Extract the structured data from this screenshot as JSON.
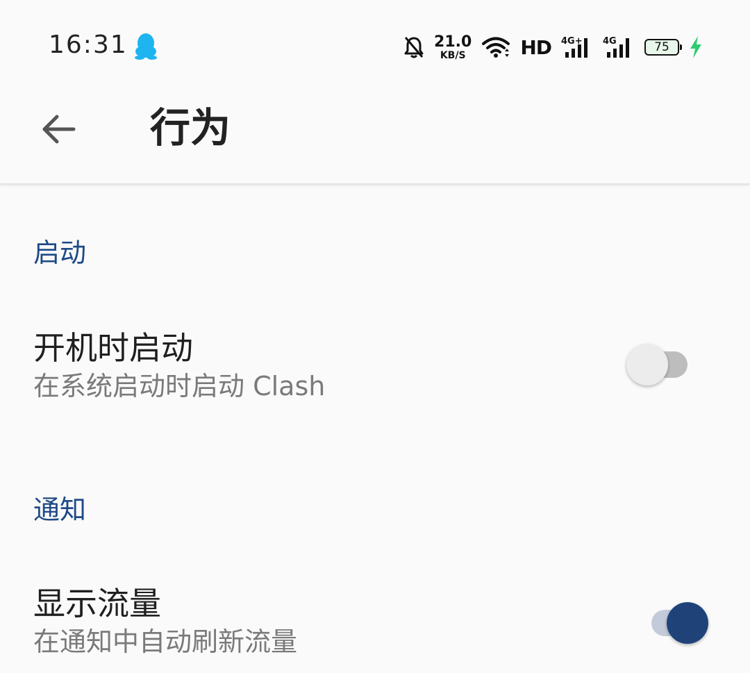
{
  "status_bar": {
    "time": "16:31",
    "net_speed_value": "21.0",
    "net_speed_unit": "KB/S",
    "hd_label": "HD",
    "signal1_label": "4G+",
    "signal2_label": "4G",
    "battery_level": "75",
    "icons": {
      "app": "qq-penguin-icon",
      "mute": "bell-off-icon",
      "wifi": "wifi-icon",
      "charging": "lightning-icon"
    },
    "colors": {
      "qq": "#1eb4f0",
      "charging": "#2ecc71"
    }
  },
  "toolbar": {
    "back_icon": "arrow-left-icon",
    "title": "行为"
  },
  "sections": [
    {
      "header": "启动",
      "items": [
        {
          "title": "开机时启动",
          "summary": "在系统启动时启动 Clash",
          "switch_on": false
        }
      ]
    },
    {
      "header": "通知",
      "items": [
        {
          "title": "显示流量",
          "summary": "在通知中自动刷新流量",
          "switch_on": true
        }
      ]
    }
  ],
  "colors": {
    "accent": "#1f4379",
    "section_header": "#1e4a86",
    "background": "#fafafa"
  }
}
